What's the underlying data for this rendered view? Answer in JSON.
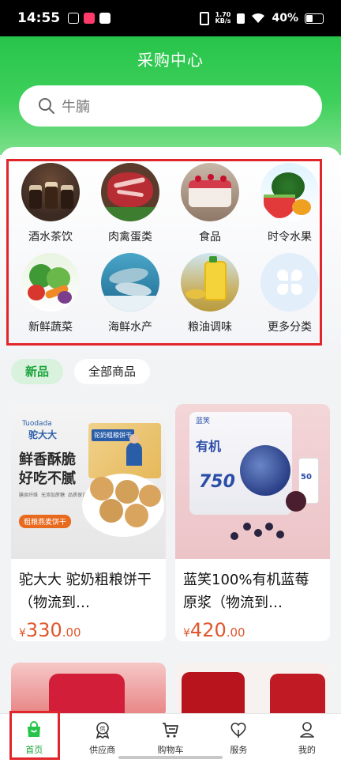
{
  "status_bar": {
    "time": "14:55",
    "network_speed_value": "1.70",
    "network_speed_unit": "KB/s",
    "battery": "40%"
  },
  "header": {
    "title": "采购中心"
  },
  "search": {
    "placeholder": "牛腩",
    "icon": "search-icon"
  },
  "categories": [
    {
      "label": "酒水茶饮",
      "icon": "drinks-photo"
    },
    {
      "label": "肉禽蛋类",
      "icon": "meat-photo"
    },
    {
      "label": "食品",
      "icon": "cake-photo"
    },
    {
      "label": "时令水果",
      "icon": "fruit-photo"
    },
    {
      "label": "新鲜蔬菜",
      "icon": "vegetable-photo"
    },
    {
      "label": "海鲜水产",
      "icon": "seafood-photo"
    },
    {
      "label": "粮油调味",
      "icon": "oil-photo"
    },
    {
      "label": "更多分类",
      "icon": "more-grid-icon"
    }
  ],
  "filter_tabs": [
    {
      "label": "新品",
      "active": true
    },
    {
      "label": "全部商品",
      "active": false
    }
  ],
  "products": [
    {
      "name": "驼大大 驼奶粗粮饼干（物流到…",
      "currency": "¥",
      "price_int": "330",
      "price_dec": ".00",
      "image_texts": {
        "brand": "驼大大",
        "brand_en": "Tuodada",
        "slogan_line1": "鲜香酥脆",
        "slogan_line2": "好吃不腻",
        "tag": "粗粮燕麦饼干",
        "box_title": "驼奶粗粮饼干",
        "badges": [
          "膳食纤维",
          "无添加蔗糖",
          "品质保证"
        ]
      }
    },
    {
      "name": "蓝笑100%有机蓝莓原浆（物流到…",
      "currency": "¥",
      "price_int": "420",
      "price_dec": ".00",
      "image_texts": {
        "brand": "蓝笑",
        "package_big": "750",
        "package_word": "有机",
        "bottle_number": "50"
      }
    }
  ],
  "tabbar": [
    {
      "label": "首页",
      "icon": "shopping-bag-icon",
      "active": true
    },
    {
      "label": "供应商",
      "icon": "supplier-badge-icon",
      "active": false
    },
    {
      "label": "购物车",
      "icon": "cart-icon",
      "active": false
    },
    {
      "label": "服务",
      "icon": "service-heart-icon",
      "active": false
    },
    {
      "label": "我的",
      "icon": "user-icon",
      "active": false
    }
  ],
  "colors": {
    "brand_green": "#27c44a",
    "active_green": "#1aa33a",
    "price_orange": "#e0562b",
    "highlight_red": "#e0262b"
  }
}
